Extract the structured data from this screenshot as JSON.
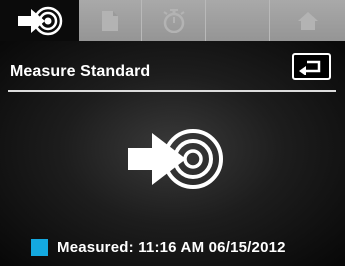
{
  "tabs": [
    {
      "icon": "measure-standard-icon",
      "active": true
    },
    {
      "icon": "document-icon",
      "active": false
    },
    {
      "icon": "timer-icon",
      "active": false
    },
    {
      "icon": "blank-tab",
      "active": false
    },
    {
      "icon": "home-icon",
      "active": false
    }
  ],
  "header": {
    "title": "Measure Standard"
  },
  "back_button": {
    "icon": "back-return-icon"
  },
  "status": {
    "swatch_color": "#14a9e0",
    "text": "Measured: 11:16 AM  06/15/2012"
  }
}
